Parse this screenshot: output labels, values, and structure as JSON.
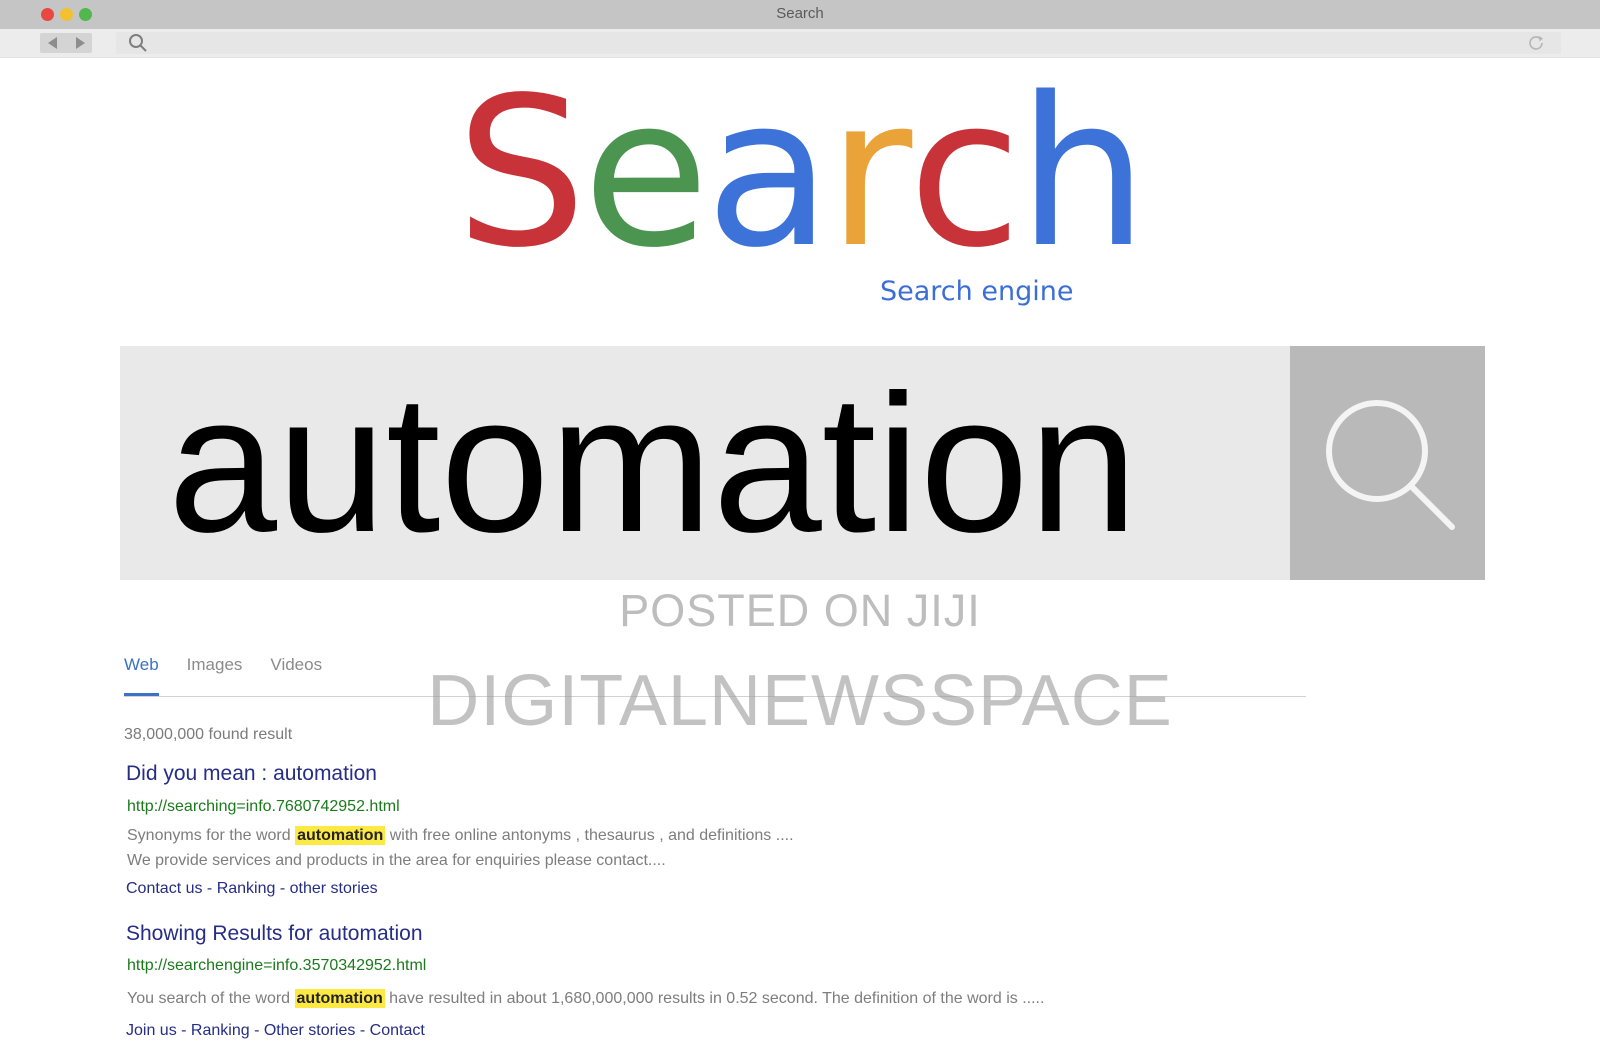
{
  "window": {
    "title": "Search"
  },
  "logo": {
    "letters": [
      {
        "char": "S",
        "color": "#c8333a"
      },
      {
        "char": "e",
        "color": "#4b9551"
      },
      {
        "char": "a",
        "color": "#3d72d8"
      },
      {
        "char": "r",
        "color": "#e9a339"
      },
      {
        "char": "c",
        "color": "#c8333a"
      },
      {
        "char": "h",
        "color": "#3d72d8"
      }
    ],
    "tagline": "Search engine"
  },
  "search": {
    "query": "automation",
    "button_icon": "magnifier-icon"
  },
  "watermarks": [
    "POSTED ON JIJI",
    "DIGITALNEWSSPACE"
  ],
  "tabs": [
    {
      "label": "Web",
      "active": true
    },
    {
      "label": "Images",
      "active": false
    },
    {
      "label": "Videos",
      "active": false
    }
  ],
  "results": {
    "count_text": "38,000,000 found result",
    "items": [
      {
        "title": "Did you mean : automation",
        "url": "http://searching=info.7680742952.html",
        "snippet_pre": "Synonyms for the word ",
        "highlight": "automation",
        "snippet_post": " with free online antonyms , thesaurus , and definitions ....",
        "snippet_line2": "We provide services and products in the area for enquiries please contact....",
        "links": "Contact us - Ranking - other stories"
      },
      {
        "title": "Showing Results for automation",
        "url": "http://searchengine=info.3570342952.html",
        "snippet_pre": "You search of the word ",
        "highlight": "automation",
        "snippet_post": " have resulted in about 1,680,000,000 results in 0.52 second. The definition of the word is .....",
        "links": "Join us - Ranking - Other stories - Contact"
      }
    ]
  }
}
